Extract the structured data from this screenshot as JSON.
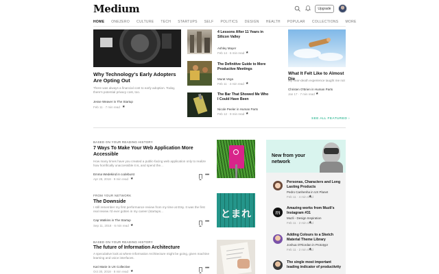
{
  "header": {
    "logo": "Medium",
    "upgrade_label": "Upgrade"
  },
  "nav": [
    "HOME",
    "ONEZERO",
    "CULTURE",
    "TECH",
    "STARTUPS",
    "SELF",
    "POLITICS",
    "DESIGN",
    "HEALTH",
    "POPULAR",
    "COLLECTIONS",
    "MORE"
  ],
  "featured_left": {
    "title": "Why Technology's Early Adopters Are Opting Out",
    "subtitle": "There was always a financial cost to early adoption. Today, there's potential privacy cost, too.",
    "author": "Jesse Weaver in The Startup",
    "date": "Feb 11 · 7 min read"
  },
  "featured_middle": [
    {
      "title": "4 Lessons After 11 Years in Silicon Valley",
      "author": "Ashley Mayer",
      "date": "Feb 14 · 6 min read"
    },
    {
      "title": "The Definitive Guide to More Productive Meetings",
      "author": "Murat Vega",
      "date": "Feb 11 · 4 min read"
    },
    {
      "title": "The Bar That Showed Me Who I Could Have Been",
      "author": "Nicole Peeler in Human Parts",
      "date": "Feb 12 · 9 min read"
    }
  ],
  "featured_right": {
    "title": "What It Felt Like to Almost Die",
    "subtitle": "My near-death experience taught me not",
    "author": "Christen O'Brien in Human Parts",
    "date": "Jan 17 · 7 min read"
  },
  "see_all": "SEE ALL FEATURED ›",
  "feed": [
    {
      "context": "BASED ON YOUR READING HISTORY",
      "title": "7 Ways To Make Your Web Application More Accessible",
      "subtitle": "How many times have you created a public-facing web application only to realize how horrifically unaccessible it is, and spend the...",
      "author": "Emma Wedekind in codeburst",
      "date": "Apr 28, 2018 · 9 min read"
    },
    {
      "context": "FROM YOUR NETWORK",
      "title": "The Downside",
      "subtitle": "I still remember my first performance review from my time at Etsy. It was the first real review I'd ever gotten in my career (startups...",
      "author": "Cap Watkins in The Startup",
      "date": "Sep 11, 2018 · 6 min read"
    },
    {
      "context": "BASED ON YOUR READING HISTORY",
      "title": "The future of Information Architecture",
      "subtitle": "A speculative look at where Information Architecture might be going, given machine learning and voice interfaces.",
      "author": "Kari Marie in UX Collective",
      "date": "Oct 30, 2018 · 8 min read"
    }
  ],
  "rail": {
    "heading": "New from your network",
    "items": [
      {
        "title": "Personas, Characters and Long Lasting Products",
        "author": "Pedro Canhenha in UX Planet",
        "date": "Feb 11 · 4 min read"
      },
      {
        "title": "Amazing works from Muzli's Instagram #31",
        "author": "Muzli - Design Inspiration",
        "date": "Feb 11 · 2 min read"
      },
      {
        "title": "Adding Colours to a Sketch Material Theme Library",
        "author": "Joshua O'Riordan in Prototypr",
        "date": "Feb 11 · 2 min read"
      },
      {
        "title": "The single most important leading indicator of productivity",
        "author": "",
        "date": ""
      }
    ]
  },
  "colors": {
    "rail_head": "#d9f4ee",
    "rail_bg": "#f2f2f2",
    "link_green": "#03a87c"
  }
}
